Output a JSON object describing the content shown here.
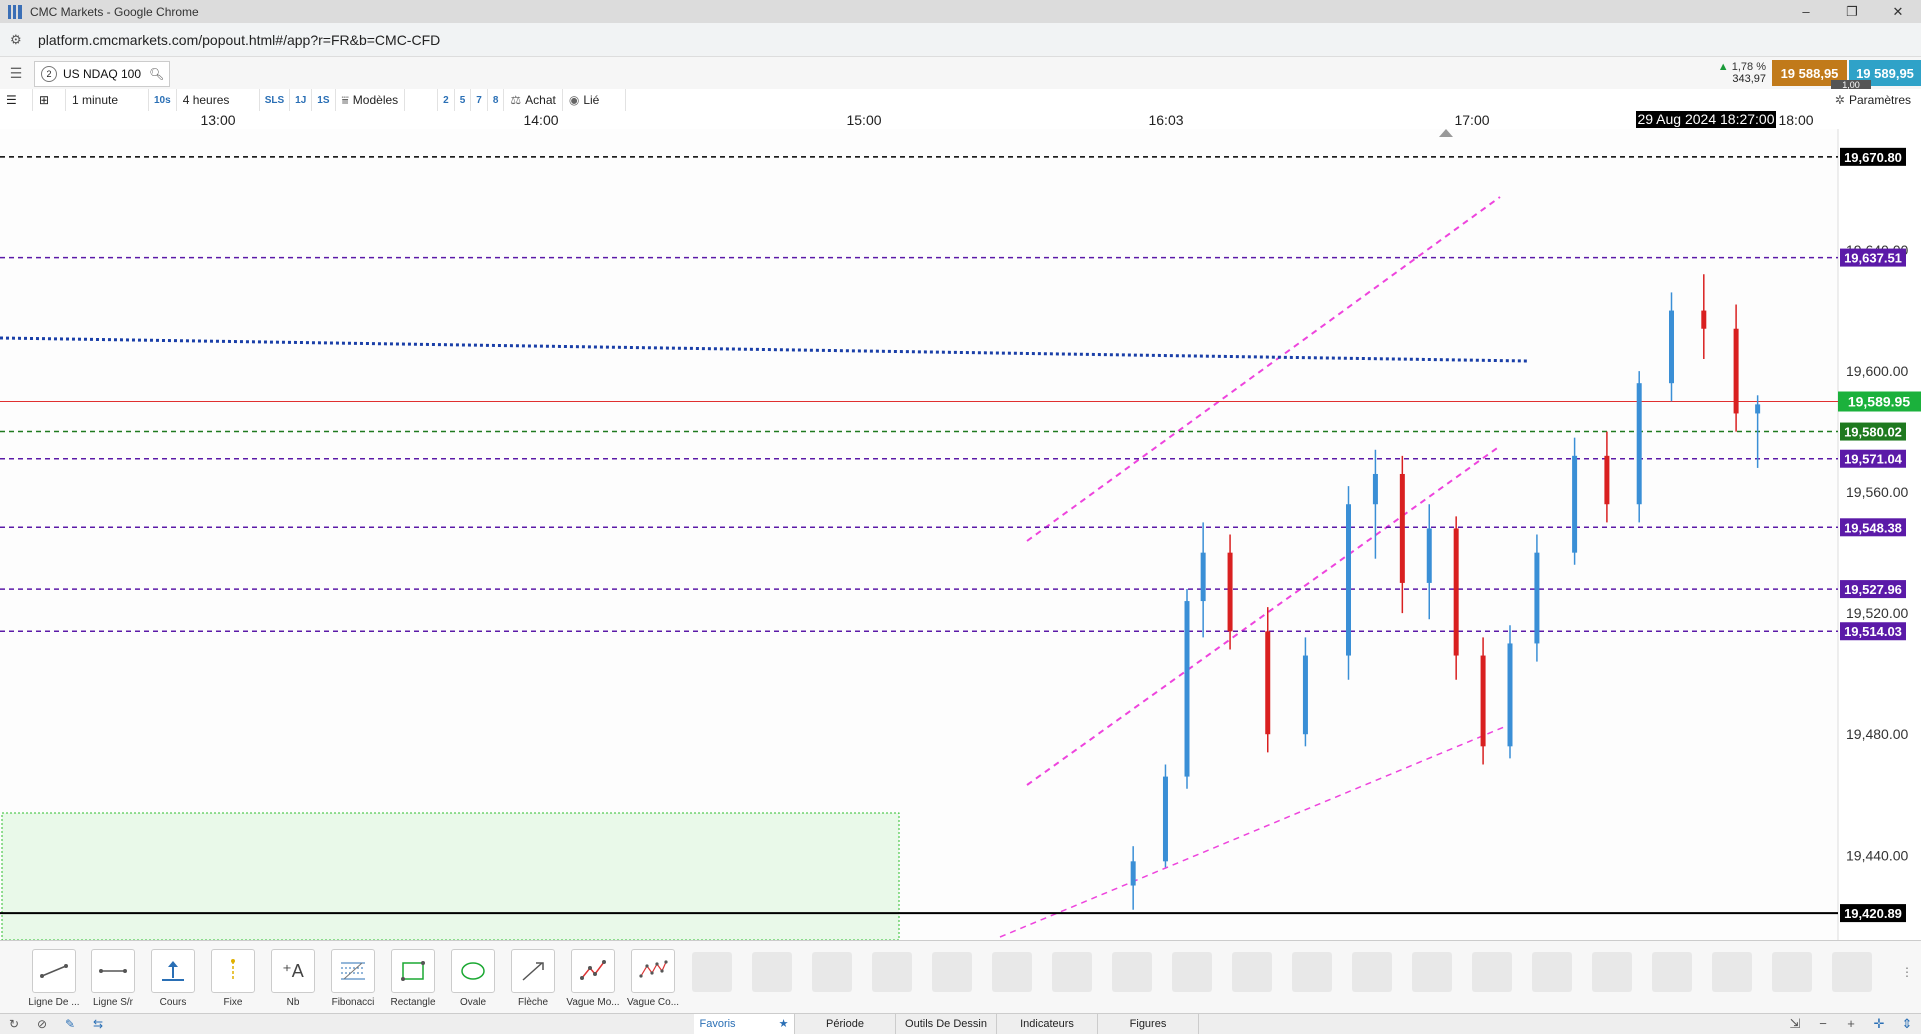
{
  "window": {
    "title": "CMC Markets - Google Chrome",
    "url": "platform.cmcmarkets.com/popout.html#/app?r=FR&b=CMC-CFD"
  },
  "header": {
    "instrument_num": "2",
    "instrument": "US NDAQ 100",
    "change_pct": "1,78 %",
    "change_pts": "343,97",
    "sell": "19 588,95",
    "buy": "19 589,95",
    "qty": "1,00"
  },
  "toolbar": {
    "interval": "1 minute",
    "i10s": "10s",
    "range": "4 heures",
    "sls": "SLS",
    "j1": "1J",
    "s1": "1S",
    "models": "Modèles",
    "n2": "2",
    "n5": "5",
    "n7": "7",
    "n8": "8",
    "buy": "Achat",
    "linked": "Lié",
    "params": "Paramètres"
  },
  "time_axis": {
    "labels": [
      "13:00",
      "14:00",
      "15:00",
      "16:03",
      "17:00",
      "18:00"
    ],
    "cursor": "29 Aug 2024 18:27:00"
  },
  "chart_data": {
    "type": "candlestick",
    "instrument": "US NDAQ 100",
    "timeframe": "1 minute",
    "x_labels": [
      "13:00",
      "14:00",
      "15:00",
      "16:03",
      "17:00",
      "18:00"
    ],
    "y_ticks": [
      19440,
      19480,
      19520,
      19560,
      19600,
      19640
    ],
    "y_tick_labels": [
      "19,440.00",
      "19,480.00",
      "19,520.00",
      "19,560.00",
      "19,600.00",
      "19,640.00"
    ],
    "ylim": [
      19412,
      19680
    ],
    "current_price": {
      "value": 19589.95,
      "label": "19,589.95",
      "color": "#1bb13c"
    },
    "levels": [
      {
        "label": "19,670.80",
        "value": 19670.8,
        "color": "#000000"
      },
      {
        "label": "19,637.51",
        "value": 19637.51,
        "color": "#5b1aa8"
      },
      {
        "label": "19,580.02",
        "value": 19580.02,
        "color": "#1f7a1f"
      },
      {
        "label": "19,571.04",
        "value": 19571.04,
        "color": "#5b1aa8"
      },
      {
        "label": "19,548.38",
        "value": 19548.38,
        "color": "#5b1aa8"
      },
      {
        "label": "19,527.96",
        "value": 19527.96,
        "color": "#5b1aa8"
      },
      {
        "label": "19,514.03",
        "value": 19514.03,
        "color": "#5b1aa8"
      },
      {
        "label": "19,420.89",
        "value": 19420.89,
        "color": "#000000"
      }
    ],
    "candles": [
      {
        "t": "15:50",
        "o": 19430,
        "h": 19443,
        "l": 19422,
        "c": 19438
      },
      {
        "t": "15:56",
        "o": 19438,
        "h": 19470,
        "l": 19436,
        "c": 19466
      },
      {
        "t": "16:00",
        "o": 19466,
        "h": 19528,
        "l": 19462,
        "c": 19524
      },
      {
        "t": "16:03",
        "o": 19524,
        "h": 19550,
        "l": 19512,
        "c": 19540
      },
      {
        "t": "16:08",
        "o": 19540,
        "h": 19546,
        "l": 19508,
        "c": 19514
      },
      {
        "t": "16:15",
        "o": 19514,
        "h": 19522,
        "l": 19474,
        "c": 19480
      },
      {
        "t": "16:22",
        "o": 19480,
        "h": 19512,
        "l": 19476,
        "c": 19506
      },
      {
        "t": "16:30",
        "o": 19506,
        "h": 19562,
        "l": 19498,
        "c": 19556
      },
      {
        "t": "16:35",
        "o": 19556,
        "h": 19574,
        "l": 19538,
        "c": 19566
      },
      {
        "t": "16:40",
        "o": 19566,
        "h": 19572,
        "l": 19520,
        "c": 19530
      },
      {
        "t": "16:45",
        "o": 19530,
        "h": 19556,
        "l": 19518,
        "c": 19548
      },
      {
        "t": "16:50",
        "o": 19548,
        "h": 19552,
        "l": 19498,
        "c": 19506
      },
      {
        "t": "16:55",
        "o": 19506,
        "h": 19512,
        "l": 19470,
        "c": 19476
      },
      {
        "t": "17:00",
        "o": 19476,
        "h": 19516,
        "l": 19472,
        "c": 19510
      },
      {
        "t": "17:05",
        "o": 19510,
        "h": 19546,
        "l": 19504,
        "c": 19540
      },
      {
        "t": "17:12",
        "o": 19540,
        "h": 19578,
        "l": 19536,
        "c": 19572
      },
      {
        "t": "17:18",
        "o": 19572,
        "h": 19580,
        "l": 19550,
        "c": 19556
      },
      {
        "t": "17:24",
        "o": 19556,
        "h": 19600,
        "l": 19550,
        "c": 19596
      },
      {
        "t": "17:30",
        "o": 19596,
        "h": 19626,
        "l": 19590,
        "c": 19620
      },
      {
        "t": "17:36",
        "o": 19620,
        "h": 19632,
        "l": 19604,
        "c": 19614
      },
      {
        "t": "17:42",
        "o": 19614,
        "h": 19622,
        "l": 19580,
        "c": 19586
      },
      {
        "t": "17:46",
        "o": 19586,
        "h": 19592,
        "l": 19568,
        "c": 19589
      }
    ]
  },
  "tools": [
    {
      "label": "Ligne De ..."
    },
    {
      "label": "Ligne S/r"
    },
    {
      "label": "Cours"
    },
    {
      "label": "Fixe"
    },
    {
      "label": "Nb"
    },
    {
      "label": "Fibonacci"
    },
    {
      "label": "Rectangle"
    },
    {
      "label": "Ovale"
    },
    {
      "label": "Flèche"
    },
    {
      "label": "Vague Mo..."
    },
    {
      "label": "Vague Co..."
    }
  ],
  "tabs": [
    "Favoris",
    "Période",
    "Outils De Dessin",
    "Indicateurs",
    "Figures"
  ]
}
